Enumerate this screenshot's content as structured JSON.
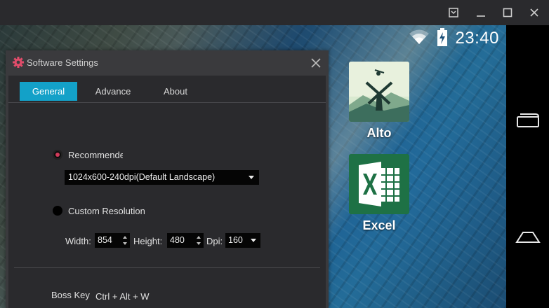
{
  "emulator": {
    "window_controls": [
      "dropdown-icon",
      "minimize-icon",
      "maximize-icon",
      "close-icon"
    ]
  },
  "android": {
    "status": {
      "time": "23:40",
      "icons": [
        "wifi-icon",
        "battery-charging-icon"
      ]
    },
    "apps": [
      {
        "label": "Alto",
        "icon": "alto-app-icon"
      },
      {
        "label": "Excel",
        "icon": "excel-app-icon"
      }
    ],
    "nav": [
      "recents-icon",
      "home-icon"
    ]
  },
  "dialog": {
    "title": "Software Settings",
    "tabs": [
      {
        "label": "General",
        "active": true
      },
      {
        "label": "Advance",
        "active": false
      },
      {
        "label": "About",
        "active": false
      }
    ],
    "general": {
      "recommended_label": "Recommended",
      "recommended_selected": true,
      "resolution_value": "1024x600-240dpi(Default Landscape)",
      "custom_label": "Custom Resolution",
      "custom_selected": false,
      "width_label": "Width:",
      "width_value": "854",
      "height_label": "Height:",
      "height_value": "480",
      "dpi_label": "Dpi:",
      "dpi_value": "160",
      "boss_key_label": "Boss Key",
      "boss_key_value": "Ctrl + Alt + W"
    }
  },
  "colors": {
    "accent": "#13a1c8",
    "radio_dot": "#d23a5a",
    "gear": "#e04c6a"
  }
}
